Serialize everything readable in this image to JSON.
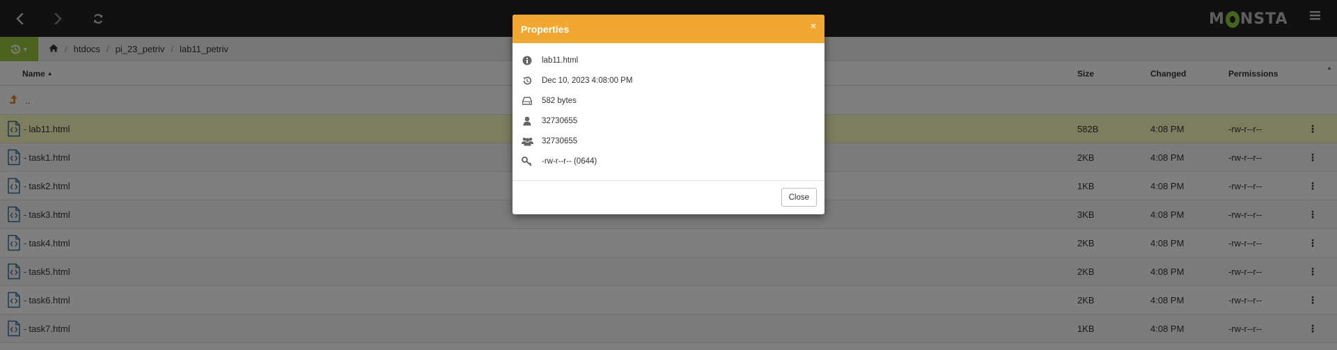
{
  "topbar": {
    "back_icon": "chevron-left-icon",
    "forward_icon": "chevron-right-icon",
    "refresh_icon": "refresh-icon",
    "logo": "MONSTA",
    "menu_icon": "hamburger-icon",
    "background": "#222222"
  },
  "breadcrumb": {
    "history_icon": "history-icon",
    "home_icon": "home-icon",
    "items": [
      "htdocs",
      "pi_23_petriv",
      "lab11_petriv"
    ],
    "accent": "#9bc43c"
  },
  "table": {
    "headers": {
      "name": "Name",
      "size": "Size",
      "changed": "Changed",
      "permissions": "Permissions"
    },
    "parent_row": {
      "label": "..",
      "icon": "up-arrow-icon"
    },
    "rows": [
      {
        "name": "lab11.html",
        "size": "582B",
        "changed": "4:08 PM",
        "permissions": "-rw-r--r--",
        "selected": true
      },
      {
        "name": "task1.html",
        "size": "2KB",
        "changed": "4:08 PM",
        "permissions": "-rw-r--r--"
      },
      {
        "name": "task2.html",
        "size": "1KB",
        "changed": "4:08 PM",
        "permissions": "-rw-r--r--"
      },
      {
        "name": "task3.html",
        "size": "3KB",
        "changed": "4:08 PM",
        "permissions": "-rw-r--r--"
      },
      {
        "name": "task4.html",
        "size": "2KB",
        "changed": "4:08 PM",
        "permissions": "-rw-r--r--"
      },
      {
        "name": "task5.html",
        "size": "2KB",
        "changed": "4:08 PM",
        "permissions": "-rw-r--r--"
      },
      {
        "name": "task6.html",
        "size": "2KB",
        "changed": "4:08 PM",
        "permissions": "-rw-r--r--"
      },
      {
        "name": "task7.html",
        "size": "1KB",
        "changed": "4:08 PM",
        "permissions": "-rw-r--r--"
      }
    ]
  },
  "modal": {
    "title": "Properties",
    "close_x": "×",
    "header_color": "#f0a830",
    "properties": [
      {
        "icon": "info-icon",
        "value": "lab11.html"
      },
      {
        "icon": "history-icon",
        "value": "Dec 10, 2023 4:08:00 PM"
      },
      {
        "icon": "hard-drive-icon",
        "value": "582 bytes"
      },
      {
        "icon": "user-icon",
        "value": "32730655"
      },
      {
        "icon": "users-icon",
        "value": "32730655"
      },
      {
        "icon": "key-icon",
        "value": "-rw-r--r-- (0644)"
      }
    ],
    "close_label": "Close"
  }
}
